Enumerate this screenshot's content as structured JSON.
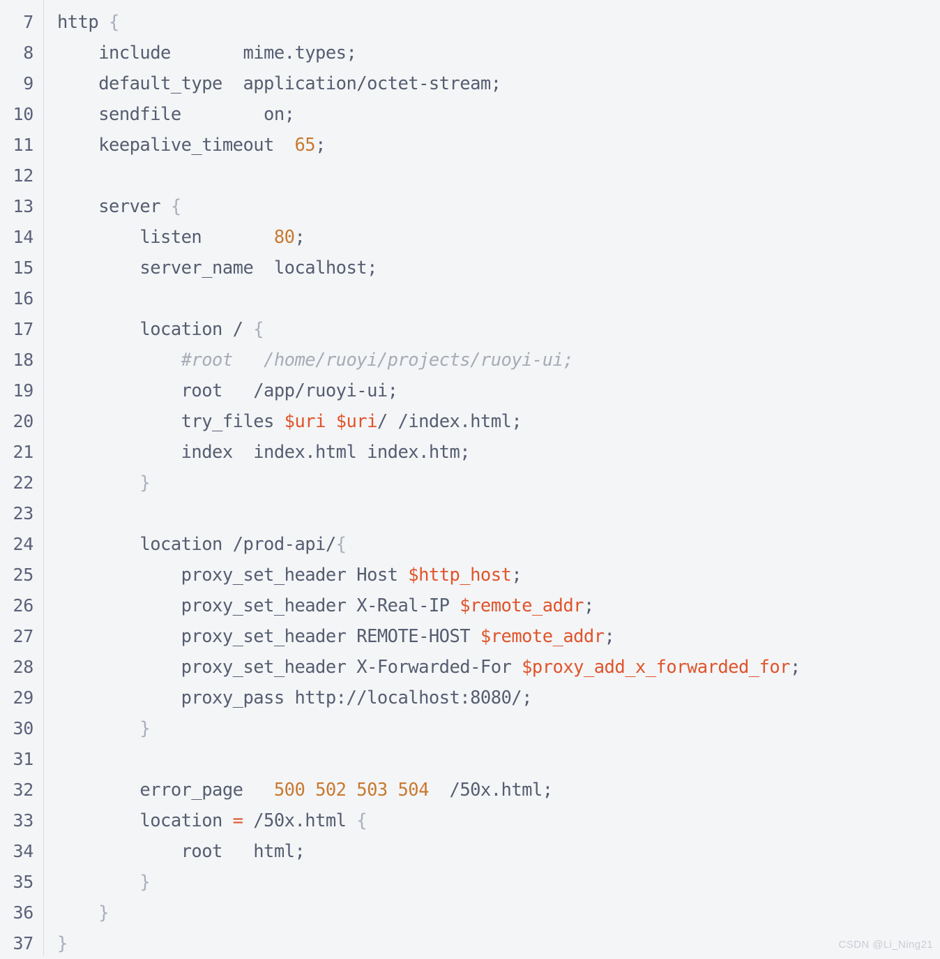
{
  "editor": {
    "language": "nginx-conf",
    "colors": {
      "background": "#f4f5f7",
      "gutter_text": "#5c6179",
      "gutter_rule": "#d7dae0",
      "text": "#555d70",
      "brace": "#a9afbb",
      "number": "#c8792e",
      "variable": "#e0542a",
      "operator": "#e0542a",
      "comment": "#a6abb6"
    },
    "first_line_number": 7,
    "last_line_number": 37,
    "lines": [
      {
        "number": "7",
        "text": "http {",
        "tokens": [
          {
            "t": "http ",
            "k": "plain"
          },
          {
            "t": "{",
            "k": "brace"
          }
        ]
      },
      {
        "number": "8",
        "text": "    include       mime.types;",
        "tokens": [
          {
            "t": "    include       mime.types;",
            "k": "plain"
          }
        ]
      },
      {
        "number": "9",
        "text": "    default_type  application/octet-stream;",
        "tokens": [
          {
            "t": "    default_type  application/octet-stream;",
            "k": "plain"
          }
        ]
      },
      {
        "number": "10",
        "text": "    sendfile        on;",
        "tokens": [
          {
            "t": "    sendfile        on;",
            "k": "plain"
          }
        ]
      },
      {
        "number": "11",
        "text": "    keepalive_timeout  65;",
        "tokens": [
          {
            "t": "    keepalive_timeout  ",
            "k": "plain"
          },
          {
            "t": "65",
            "k": "num"
          },
          {
            "t": ";",
            "k": "plain"
          }
        ]
      },
      {
        "number": "12",
        "text": "",
        "tokens": []
      },
      {
        "number": "13",
        "text": "    server {",
        "tokens": [
          {
            "t": "    server ",
            "k": "plain"
          },
          {
            "t": "{",
            "k": "brace"
          }
        ]
      },
      {
        "number": "14",
        "text": "        listen       80;",
        "tokens": [
          {
            "t": "        listen       ",
            "k": "plain"
          },
          {
            "t": "80",
            "k": "num"
          },
          {
            "t": ";",
            "k": "plain"
          }
        ]
      },
      {
        "number": "15",
        "text": "        server_name  localhost;",
        "tokens": [
          {
            "t": "        server_name  localhost;",
            "k": "plain"
          }
        ]
      },
      {
        "number": "16",
        "text": "",
        "tokens": []
      },
      {
        "number": "17",
        "text": "        location / {",
        "tokens": [
          {
            "t": "        location / ",
            "k": "plain"
          },
          {
            "t": "{",
            "k": "brace"
          }
        ]
      },
      {
        "number": "18",
        "text": "            #root   /home/ruoyi/projects/ruoyi-ui;",
        "tokens": [
          {
            "t": "            ",
            "k": "plain"
          },
          {
            "t": "#root   /home/ruoyi/projects/ruoyi-ui;",
            "k": "comment"
          }
        ]
      },
      {
        "number": "19",
        "text": "            root   /app/ruoyi-ui;",
        "tokens": [
          {
            "t": "            root   /app/ruoyi-ui;",
            "k": "plain"
          }
        ]
      },
      {
        "number": "20",
        "text": "            try_files $uri $uri/ /index.html;",
        "tokens": [
          {
            "t": "            try_files ",
            "k": "plain"
          },
          {
            "t": "$uri",
            "k": "var"
          },
          {
            "t": " ",
            "k": "plain"
          },
          {
            "t": "$uri",
            "k": "var"
          },
          {
            "t": "/ /index.html;",
            "k": "plain"
          }
        ]
      },
      {
        "number": "21",
        "text": "            index  index.html index.htm;",
        "tokens": [
          {
            "t": "            index  index.html index.htm;",
            "k": "plain"
          }
        ]
      },
      {
        "number": "22",
        "text": "        }",
        "tokens": [
          {
            "t": "        ",
            "k": "plain"
          },
          {
            "t": "}",
            "k": "brace"
          }
        ]
      },
      {
        "number": "23",
        "text": "",
        "tokens": []
      },
      {
        "number": "24",
        "text": "        location /prod-api/{",
        "tokens": [
          {
            "t": "        location /prod-api/",
            "k": "plain"
          },
          {
            "t": "{",
            "k": "brace"
          }
        ]
      },
      {
        "number": "25",
        "text": "            proxy_set_header Host $http_host;",
        "tokens": [
          {
            "t": "            proxy_set_header Host ",
            "k": "plain"
          },
          {
            "t": "$http_host",
            "k": "var"
          },
          {
            "t": ";",
            "k": "plain"
          }
        ]
      },
      {
        "number": "26",
        "text": "            proxy_set_header X-Real-IP $remote_addr;",
        "tokens": [
          {
            "t": "            proxy_set_header X-Real-IP ",
            "k": "plain"
          },
          {
            "t": "$remote_addr",
            "k": "var"
          },
          {
            "t": ";",
            "k": "plain"
          }
        ]
      },
      {
        "number": "27",
        "text": "            proxy_set_header REMOTE-HOST $remote_addr;",
        "tokens": [
          {
            "t": "            proxy_set_header REMOTE-HOST ",
            "k": "plain"
          },
          {
            "t": "$remote_addr",
            "k": "var"
          },
          {
            "t": ";",
            "k": "plain"
          }
        ]
      },
      {
        "number": "28",
        "text": "            proxy_set_header X-Forwarded-For $proxy_add_x_forwarded_for;",
        "tokens": [
          {
            "t": "            proxy_set_header X-Forwarded-For ",
            "k": "plain"
          },
          {
            "t": "$proxy_add_x_forwarded_for",
            "k": "var"
          },
          {
            "t": ";",
            "k": "plain"
          }
        ]
      },
      {
        "number": "29",
        "text": "            proxy_pass http://localhost:8080/;",
        "tokens": [
          {
            "t": "            proxy_pass http://localhost:8080/;",
            "k": "plain"
          }
        ]
      },
      {
        "number": "30",
        "text": "        }",
        "tokens": [
          {
            "t": "        ",
            "k": "plain"
          },
          {
            "t": "}",
            "k": "brace"
          }
        ]
      },
      {
        "number": "31",
        "text": "",
        "tokens": []
      },
      {
        "number": "32",
        "text": "        error_page   500 502 503 504  /50x.html;",
        "tokens": [
          {
            "t": "        error_page   ",
            "k": "plain"
          },
          {
            "t": "500 502 503 504",
            "k": "num"
          },
          {
            "t": "  /50x.html;",
            "k": "plain"
          }
        ]
      },
      {
        "number": "33",
        "text": "        location = /50x.html {",
        "tokens": [
          {
            "t": "        location ",
            "k": "plain"
          },
          {
            "t": "=",
            "k": "op"
          },
          {
            "t": " /50x.html ",
            "k": "plain"
          },
          {
            "t": "{",
            "k": "brace"
          }
        ]
      },
      {
        "number": "34",
        "text": "            root   html;",
        "tokens": [
          {
            "t": "            root   html;",
            "k": "plain"
          }
        ]
      },
      {
        "number": "35",
        "text": "        }",
        "tokens": [
          {
            "t": "        ",
            "k": "plain"
          },
          {
            "t": "}",
            "k": "brace"
          }
        ]
      },
      {
        "number": "36",
        "text": "    }",
        "tokens": [
          {
            "t": "    ",
            "k": "plain"
          },
          {
            "t": "}",
            "k": "brace"
          }
        ]
      },
      {
        "number": "37",
        "text": "}",
        "tokens": [
          {
            "t": "}",
            "k": "brace"
          }
        ]
      }
    ]
  },
  "watermark": {
    "text": "CSDN @Li_Ning21"
  }
}
